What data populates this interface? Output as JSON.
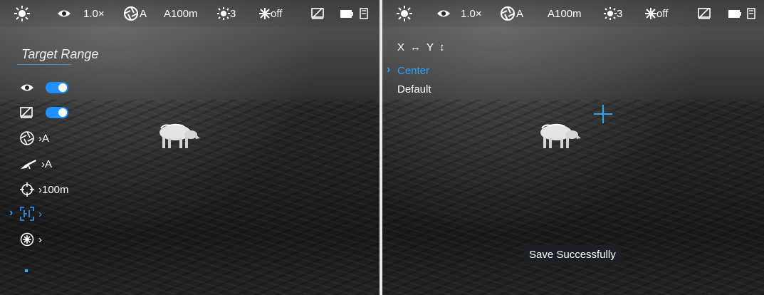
{
  "statusbar": {
    "zoom": "1.0×",
    "mode": "A",
    "range": "A100m",
    "brightness": "3",
    "ir": "off"
  },
  "left": {
    "menu_title": "Target Range",
    "items": [
      {
        "icon": "eye-icon",
        "type": "toggle",
        "state": "on"
      },
      {
        "icon": "pip-off-icon",
        "type": "toggle",
        "state": "on"
      },
      {
        "icon": "aperture-icon",
        "value": "›A"
      },
      {
        "icon": "rifle-icon",
        "value": "›A"
      },
      {
        "icon": "crosshair-target-icon",
        "value": "›100m"
      },
      {
        "icon": "calibration-icon",
        "value": "›"
      },
      {
        "icon": "star-settings-icon",
        "value": "›"
      }
    ]
  },
  "right": {
    "align_x": "X",
    "align_y": "Y",
    "options": [
      "Center",
      "Default"
    ],
    "toast": "Save Successfully"
  },
  "colors": {
    "accent": "#1e90ff",
    "crosshair": "#2aa7f2"
  }
}
